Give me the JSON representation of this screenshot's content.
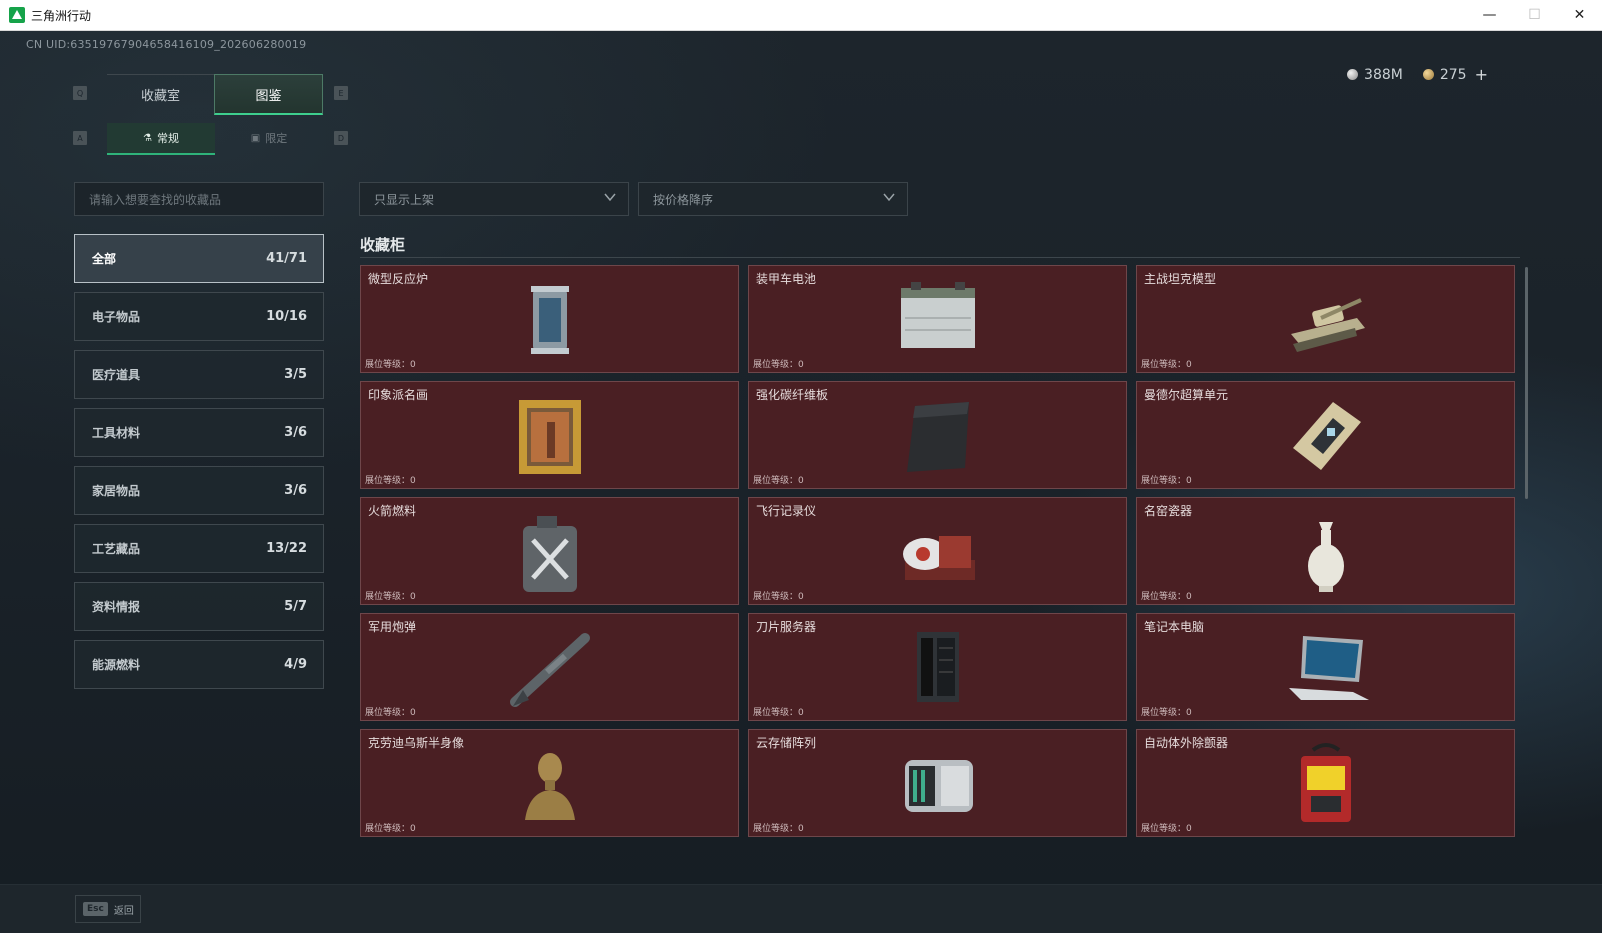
{
  "window": {
    "title": "三角洲行动",
    "controls": {
      "minimize": "—",
      "maximize": "☐",
      "close": "✕"
    }
  },
  "header": {
    "uid": "CN UID:6351976790465841​6109_202606280019",
    "currency": [
      {
        "icon": "silver-coin-icon",
        "value": "388M"
      },
      {
        "icon": "gold-coin-icon",
        "value": "275"
      }
    ],
    "add_label": "+"
  },
  "tabs": {
    "key_left": "Q",
    "key_right": "E",
    "items": [
      {
        "label": "收藏室",
        "active": false
      },
      {
        "label": "图鉴",
        "active": true
      }
    ]
  },
  "subtabs": {
    "key_left": "A",
    "key_right": "D",
    "items": [
      {
        "label": "常规",
        "icon": "flask-icon",
        "active": true
      },
      {
        "label": "限定",
        "icon": "image-icon",
        "active": false
      }
    ]
  },
  "search": {
    "placeholder": "请输入想要查找的收藏品"
  },
  "filters": {
    "show": "只显示上架",
    "sort": "按价格降序"
  },
  "categories": [
    {
      "label": "全部",
      "count": "41/71",
      "active": true
    },
    {
      "label": "电子物品",
      "count": "10/16"
    },
    {
      "label": "医疗道具",
      "count": "3/5"
    },
    {
      "label": "工具材料",
      "count": "3/6"
    },
    {
      "label": "家居物品",
      "count": "3/6"
    },
    {
      "label": "工艺藏品",
      "count": "13/22"
    },
    {
      "label": "资料情报",
      "count": "5/7"
    },
    {
      "label": "能源燃料",
      "count": "4/9"
    }
  ],
  "collection": {
    "title": "收藏柜",
    "level_label": "展位等级：",
    "items": [
      {
        "name": "微型反应炉",
        "level": "0",
        "icon": "reactor-icon"
      },
      {
        "name": "装甲车电池",
        "level": "0",
        "icon": "battery-icon"
      },
      {
        "name": "主战坦克模型",
        "level": "0",
        "icon": "tank-icon"
      },
      {
        "name": "印象派名画",
        "level": "0",
        "icon": "painting-icon"
      },
      {
        "name": "强化碳纤维板",
        "level": "0",
        "icon": "carbon-plate-icon"
      },
      {
        "name": "曼德尔超算单元",
        "level": "0",
        "icon": "chip-icon"
      },
      {
        "name": "火箭燃料",
        "level": "0",
        "icon": "fuel-can-icon"
      },
      {
        "name": "飞行记录仪",
        "level": "0",
        "icon": "flight-recorder-icon"
      },
      {
        "name": "名窑瓷器",
        "level": "0",
        "icon": "porcelain-vase-icon"
      },
      {
        "name": "军用炮弹",
        "level": "0",
        "icon": "missile-icon"
      },
      {
        "name": "刀片服务器",
        "level": "0",
        "icon": "server-icon"
      },
      {
        "name": "笔记本电脑",
        "level": "0",
        "icon": "laptop-icon"
      },
      {
        "name": "克劳迪乌斯半身像",
        "level": "0",
        "icon": "bust-icon"
      },
      {
        "name": "云存储阵列",
        "level": "0",
        "icon": "storage-array-icon"
      },
      {
        "name": "自动体外除颤器",
        "level": "0",
        "icon": "defibrillator-icon"
      }
    ]
  },
  "footer": {
    "esc_key": "Esc",
    "back_label": "返回"
  }
}
